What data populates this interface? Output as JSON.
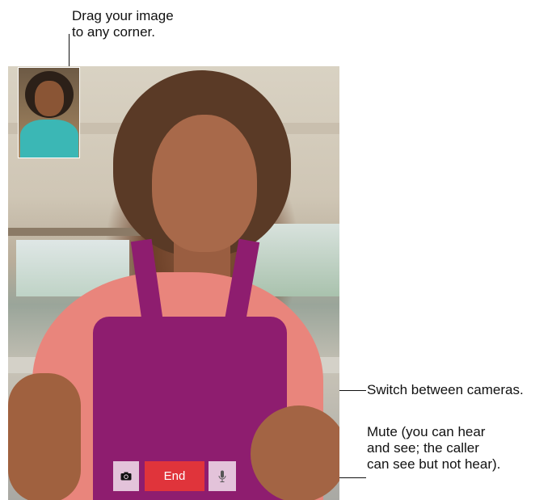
{
  "callouts": {
    "drag": "Drag your image\nto any corner.",
    "switch_cameras": "Switch between cameras.",
    "mute": "Mute (you can hear\nand see; the caller\ncan see but not hear)."
  },
  "call_controls": {
    "end_label": "End",
    "camera_icon": "camera-switch-icon",
    "mute_icon": "microphone-icon"
  },
  "colors": {
    "end_button": "#e0343b",
    "control_button": "#ecd6e6"
  }
}
